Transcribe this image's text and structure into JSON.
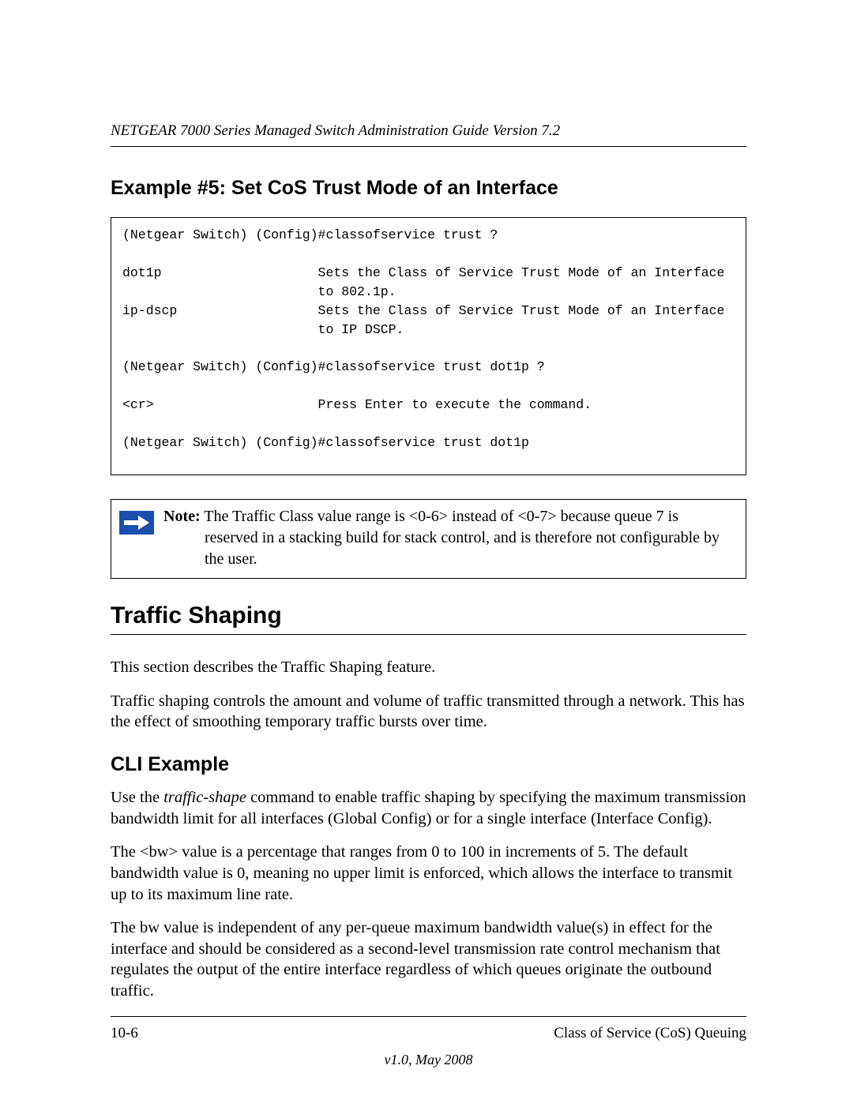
{
  "header": {
    "running_title": "NETGEAR 7000 Series Managed Switch Administration Guide Version 7.2"
  },
  "example5": {
    "heading": "Example #5: Set CoS Trust Mode of an Interface",
    "code": "(Netgear Switch) (Config)#classofservice trust ?\n\ndot1p                    Sets the Class of Service Trust Mode of an Interface\n                         to 802.1p.\nip-dscp                  Sets the Class of Service Trust Mode of an Interface\n                         to IP DSCP.\n\n(Netgear Switch) (Config)#classofservice trust dot1p ?\n\n<cr>                     Press Enter to execute the command.\n\n(Netgear Switch) (Config)#classofservice trust dot1p"
  },
  "note": {
    "label": "Note:",
    "text_line1": " The Traffic Class value range is <0-6> instead of <0-7> because queue 7 is",
    "text_rest": "reserved in a stacking build for stack control, and is therefore not configurable by the user."
  },
  "traffic_shaping": {
    "heading": "Traffic Shaping",
    "p1": "This section describes the Traffic Shaping feature.",
    "p2": "Traffic shaping controls the amount and volume of traffic transmitted through a network. This has the effect of smoothing temporary traffic bursts over time."
  },
  "cli_example": {
    "heading": "CLI Example",
    "p1_pre": "Use the ",
    "p1_em": "traffic-shape",
    "p1_post": " command to enable traffic shaping by specifying the maximum transmission bandwidth limit for all interfaces (Global Config) or for a single interface (Interface Config).",
    "p2": "The <bw> value is a percentage that ranges from 0 to 100 in increments of 5. The default bandwidth value is 0, meaning no upper limit is enforced, which allows the interface to transmit up to its maximum line rate.",
    "p3": "The bw value is independent of any per-queue maximum bandwidth value(s) in effect for the interface and should be considered as a second-level transmission rate control mechanism that regulates the output of the entire interface regardless of which queues originate the outbound traffic."
  },
  "footer": {
    "page_num": "10-6",
    "section": "Class of Service (CoS) Queuing",
    "version": "v1.0, May 2008"
  }
}
